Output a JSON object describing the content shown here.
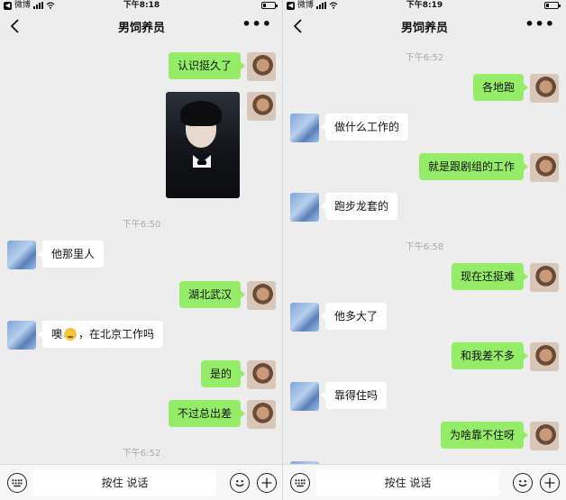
{
  "colors": {
    "sent_bubble": "#95ec69",
    "received_bubble": "#ffffff",
    "background": "#ededed"
  },
  "left": {
    "status": {
      "app": "微博",
      "time": "下午8:18"
    },
    "title": "男饲养员",
    "more": "•••",
    "messages": [
      {
        "side": "right",
        "text": "认识挺久了"
      },
      {
        "side": "right",
        "type": "photo",
        "icon": "portrait-photo"
      },
      {
        "time": "下午6:50"
      },
      {
        "side": "left",
        "text": "他那里人"
      },
      {
        "side": "right",
        "text": "湖北武汉"
      },
      {
        "side": "left",
        "pre": "噢",
        "emoji": "pensive-face-emoji",
        "text": "，在北京工作吗"
      },
      {
        "side": "right",
        "text": "是的"
      },
      {
        "side": "right",
        "text": "不过总出差"
      },
      {
        "time": "下午6:52"
      }
    ],
    "input": {
      "hold_label": "按住 说话"
    }
  },
  "right": {
    "status": {
      "app": "微博",
      "time": "下午8:19"
    },
    "title": "男饲养员",
    "more": "•••",
    "messages": [
      {
        "time": "下午6:52"
      },
      {
        "side": "right",
        "text": "各地跑"
      },
      {
        "side": "left",
        "text": "做什么工作的"
      },
      {
        "side": "right",
        "text": "就是跟剧组的工作"
      },
      {
        "side": "left",
        "text": "跑步龙套的"
      },
      {
        "time": "下午6:58"
      },
      {
        "side": "right",
        "text": "现在还挺难"
      },
      {
        "side": "left",
        "text": "他多大了"
      },
      {
        "side": "right",
        "text": "和我差不多"
      },
      {
        "side": "left",
        "text": "靠得住吗"
      },
      {
        "side": "right",
        "text": "为啥靠不住呀"
      }
    ],
    "input": {
      "hold_label": "按住 说话"
    }
  }
}
